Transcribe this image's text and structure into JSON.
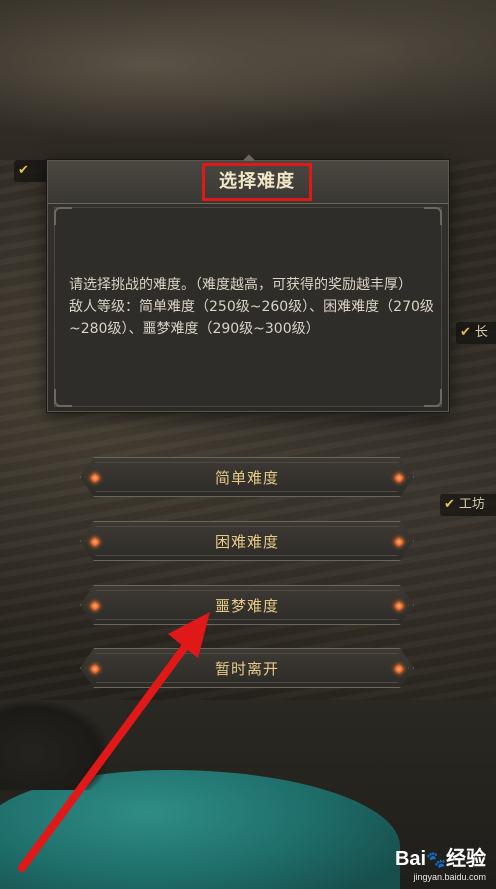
{
  "dialog": {
    "title": "选择难度",
    "description_lines": [
      "请选择挑战的难度。（难度越高，可获得的奖励越丰厚）",
      "敌人等级：简单难度（250级~260级）、困难难度（270级~280级）、噩梦难度（290级~300级）"
    ]
  },
  "options": [
    {
      "label": "简单难度"
    },
    {
      "label": "困难难度"
    },
    {
      "label": "噩梦难度"
    },
    {
      "label": "暂时离开"
    }
  ],
  "background_tags": {
    "right_top": "长",
    "right_bottom": "工坊"
  },
  "watermark": {
    "brand": "Bai",
    "brand_suffix": "经验",
    "url": "jingyan.baidu.com"
  },
  "colors": {
    "annotation_red": "#e01818",
    "option_text": "#e6c98a",
    "gem": "#e0662a"
  }
}
